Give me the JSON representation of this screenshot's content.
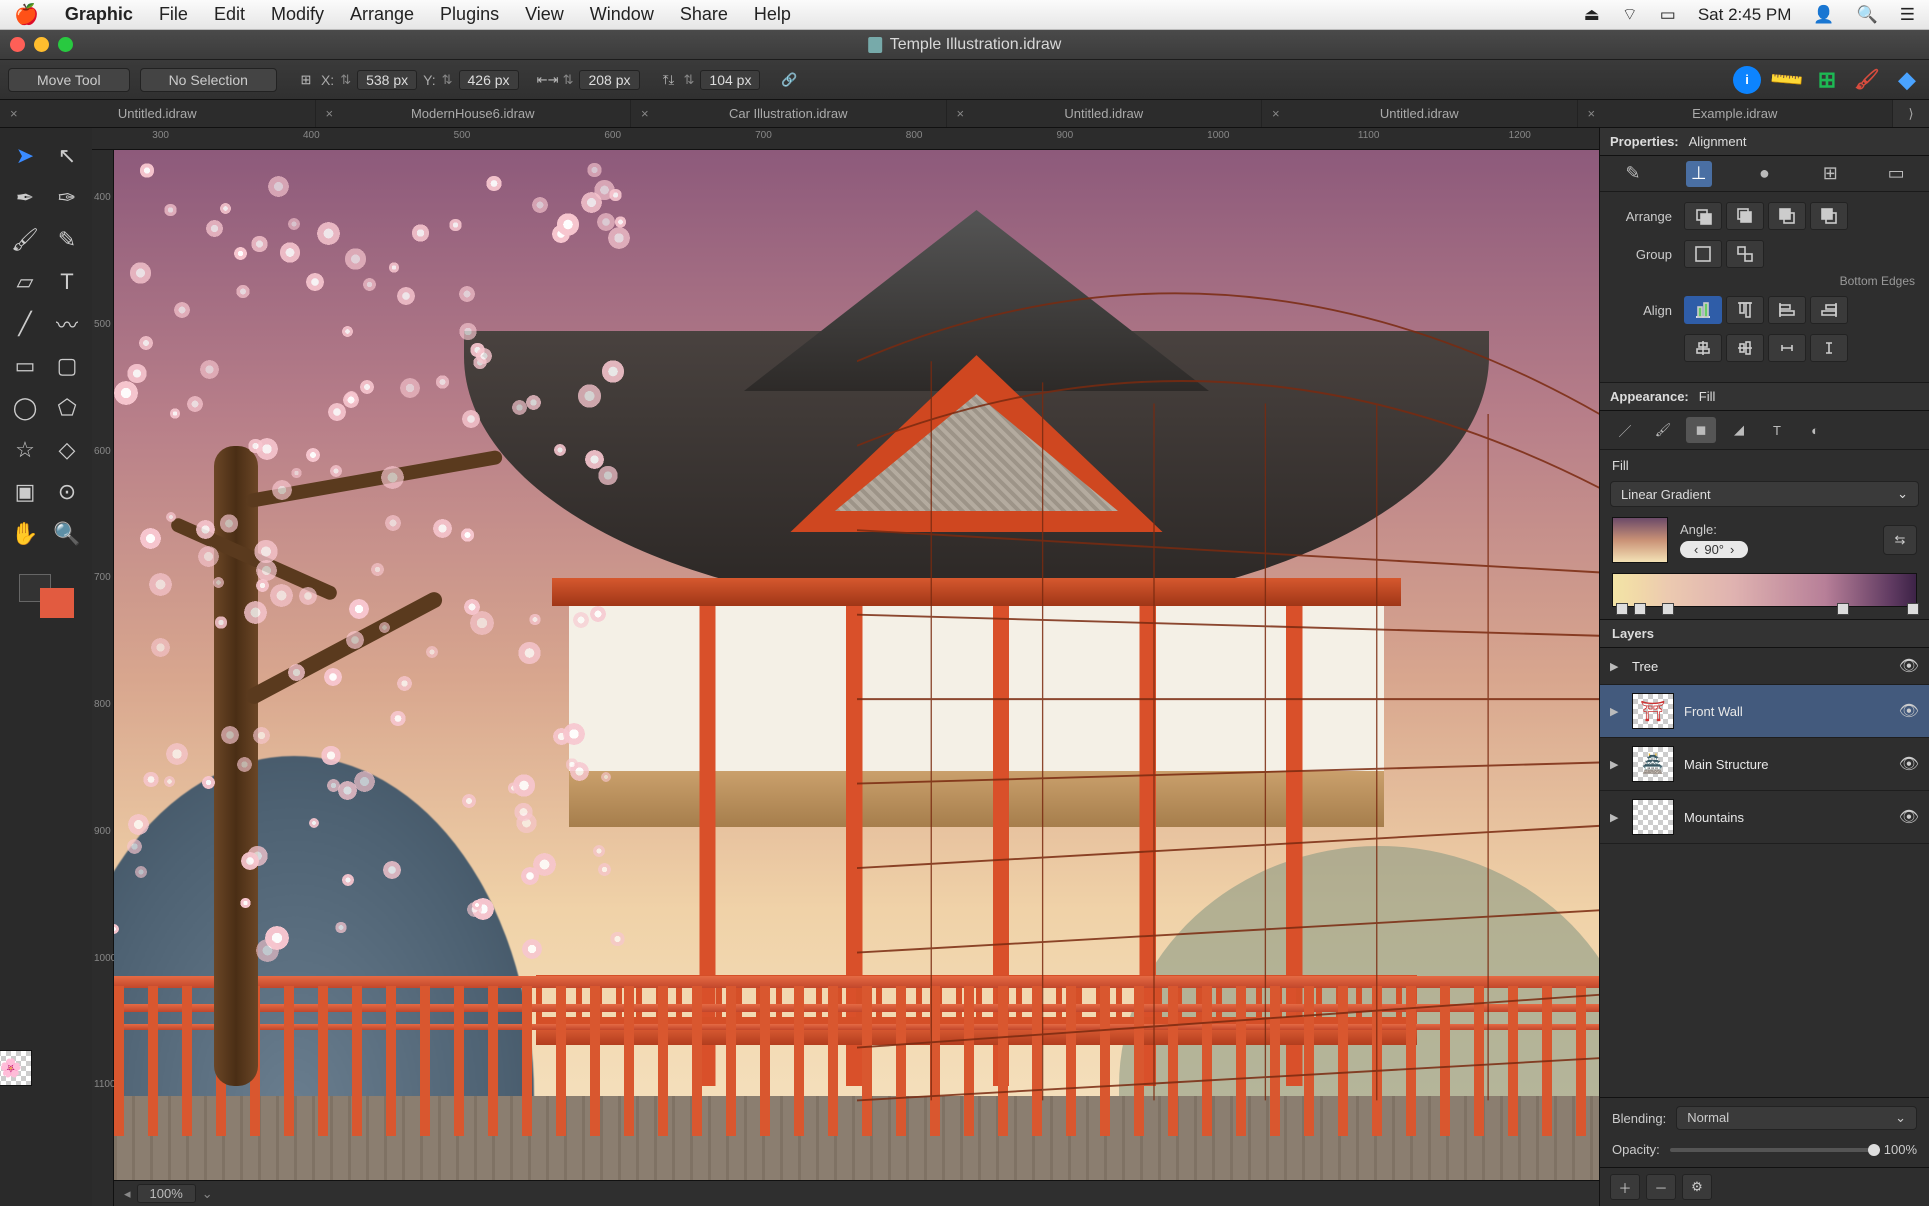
{
  "menubar": {
    "app": "Graphic",
    "items": [
      "File",
      "Edit",
      "Modify",
      "Arrange",
      "Plugins",
      "View",
      "Window",
      "Share",
      "Help"
    ],
    "clock": "Sat 2:45 PM"
  },
  "window": {
    "title": "Temple Illustration.idraw"
  },
  "toolbar": {
    "tool_label": "Move Tool",
    "selection_label": "No Selection",
    "x_label": "X:",
    "x_value": "538 px",
    "y_label": "Y:",
    "y_value": "426 px",
    "w_value": "208 px",
    "h_value": "104 px"
  },
  "tabs": [
    "Untitled.idraw",
    "ModernHouse6.idraw",
    "Car Illustration.idraw",
    "Untitled.idraw",
    "Untitled.idraw",
    "Example.idraw"
  ],
  "ruler_h": [
    "300",
    "400",
    "500",
    "600",
    "700",
    "800",
    "900",
    "1000",
    "1100",
    "1200"
  ],
  "ruler_v": [
    "400",
    "500",
    "600",
    "700",
    "800",
    "900",
    "1000",
    "1100"
  ],
  "statusbar": {
    "zoom": "100%"
  },
  "properties": {
    "header_label": "Properties:",
    "header_mode": "Alignment",
    "arrange_label": "Arrange",
    "group_label": "Group",
    "align_label": "Align",
    "align_hint": "Bottom Edges",
    "appearance_label": "Appearance:",
    "appearance_mode": "Fill",
    "fill_label": "Fill",
    "fill_type": "Linear Gradient",
    "angle_label": "Angle:",
    "angle_value": "90°",
    "layers_label": "Layers",
    "layers": [
      {
        "name": "Tree"
      },
      {
        "name": "Front Wall"
      },
      {
        "name": "Main Structure"
      },
      {
        "name": "Mountains"
      }
    ],
    "blending_label": "Blending:",
    "blending_value": "Normal",
    "opacity_label": "Opacity:",
    "opacity_value": "100%"
  }
}
